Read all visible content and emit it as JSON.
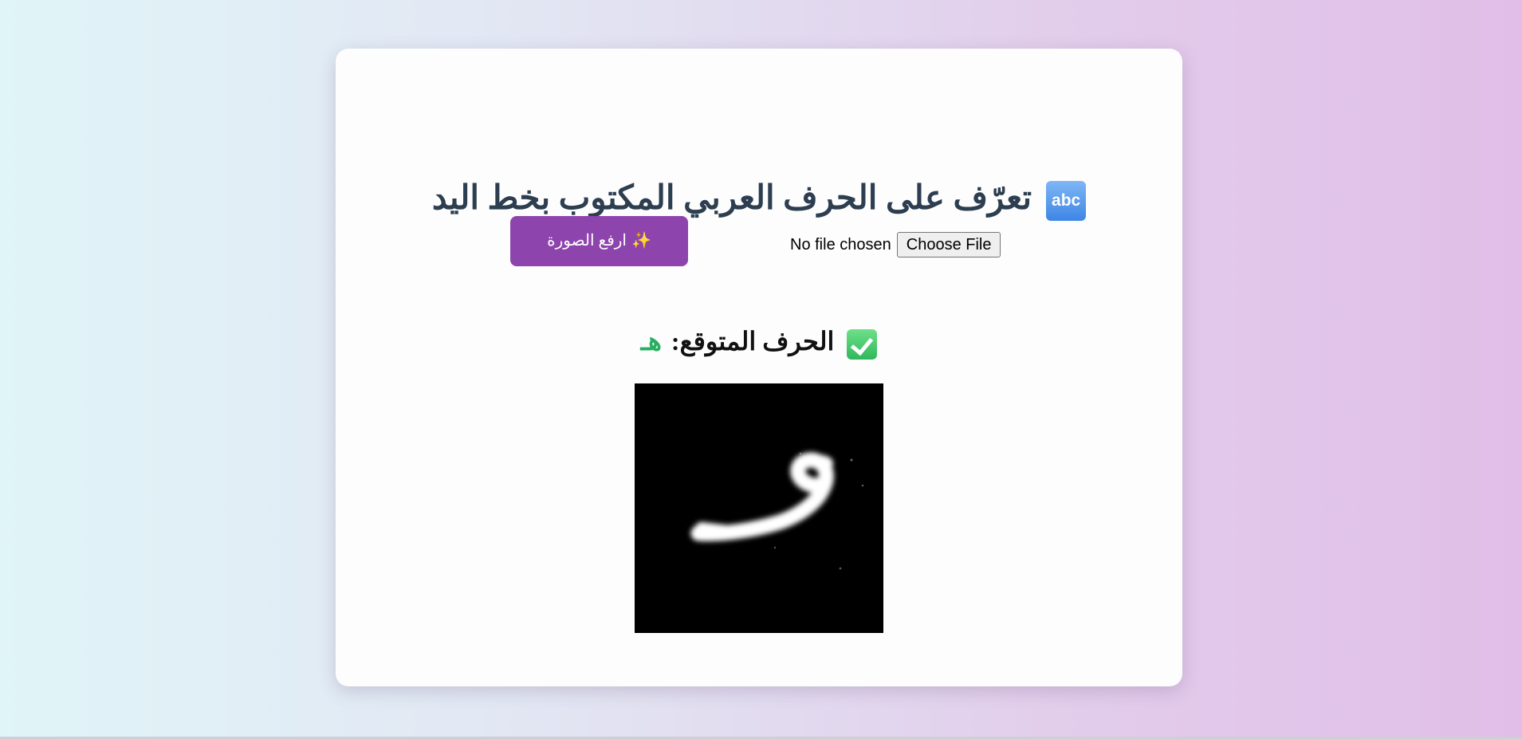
{
  "page": {
    "title_icon_text": "abc",
    "title": "تعرّف على الحرف العربي المكتوب بخط اليد",
    "background_colors": [
      "#e0f5f8",
      "#e1bee8"
    ]
  },
  "upload": {
    "button_icon": "✨",
    "button_label": "ارفع الصورة",
    "button_color": "#8e44ad",
    "file_status": "No file chosen",
    "choose_file_label": "Choose File"
  },
  "result": {
    "label": "الحرف المتوقع:",
    "value": "هـ",
    "value_color": "#27ae60",
    "icon": "check-mark-icon"
  },
  "preview": {
    "image": "handwritten-letter-image"
  }
}
